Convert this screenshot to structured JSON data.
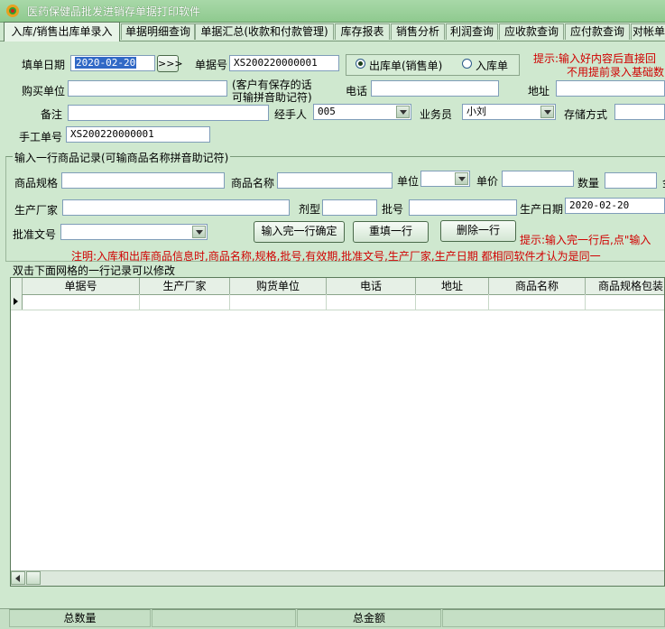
{
  "window": {
    "title": "医药保健品批发进销存单据打印软件"
  },
  "tabs": [
    "入库/销售出库单录入",
    "单据明细查询",
    "单据汇总(收款和付款管理)",
    "库存报表",
    "销售分析",
    "利润查询",
    "应收款查询",
    "应付款查询",
    "对帐单"
  ],
  "form": {
    "date_label": "填单日期",
    "date_value": "2020-02-20",
    "date_btn": ">>>",
    "order_no_label": "单据号",
    "order_no_value": "XS200220000001",
    "radio_out": "出库单(销售单)",
    "radio_in": "入库单",
    "hint_line1": "提示:输入好内容后直接回",
    "hint_line2": "不用提前录入基础数",
    "buyer_label": "购买单位",
    "buyer_note_line1": "(客户有保存的话",
    "buyer_note_line2": "可输拼音助记符)",
    "phone_label": "电话",
    "address_label": "地址",
    "remark_label": "备注",
    "handler_label": "经手人",
    "handler_value": "005",
    "salesman_label": "业务员",
    "salesman_value": "小刘",
    "storage_label": "存储方式",
    "manual_no_label": "手工单号",
    "manual_no_value": "XS200220000001"
  },
  "item_section": {
    "title": "输入一行商品记录(可输商品名称拼音助记符)",
    "spec_label": "商品规格",
    "name_label": "商品名称",
    "unit_label": "单位",
    "price_label": "单价",
    "qty_label": "数量",
    "qty_extra": "金",
    "maker_label": "生产厂家",
    "form_label": "剂型",
    "batch_label": "批号",
    "prod_date_label": "生产日期",
    "prod_date_value": "2020-02-20",
    "approval_label": "批准文号",
    "btn_confirm": "输入完一行确定",
    "btn_refill": "重填一行",
    "btn_delete": "删除一行",
    "hint_row": "提示:输入完一行后,点\"输入",
    "note": "注明:入库和出库商品信息时,商品名称,规格,批号,有效期,批准文号,生产厂家,生产日期 都相同软件才认为是同一"
  },
  "grid": {
    "title": "双击下面网格的一行记录可以修改",
    "columns": [
      "单据号",
      "生产厂家",
      "购货单位",
      "电话",
      "地址",
      "商品名称",
      "商品规格包装"
    ]
  },
  "status": {
    "total_qty_label": "总数量",
    "total_amount_label": "总金额"
  }
}
